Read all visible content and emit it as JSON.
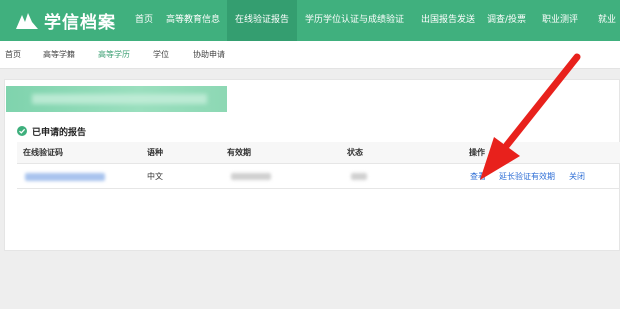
{
  "brand": {
    "name": "学信档案",
    "accent": "#40b07e"
  },
  "topnav": {
    "items": [
      {
        "label": "首页"
      },
      {
        "label": "高等教育信息"
      },
      {
        "label": "在线验证报告"
      },
      {
        "label": "学历学位认证与成绩验证"
      },
      {
        "label": "出国报告发送"
      },
      {
        "label": "调查/投票"
      },
      {
        "label": "职业测评"
      },
      {
        "label": "就业"
      }
    ],
    "active_index": 2
  },
  "subnav": {
    "items": [
      {
        "label": "首页"
      },
      {
        "label": "高等学籍"
      },
      {
        "label": "高等学历"
      },
      {
        "label": "学位"
      },
      {
        "label": "协助申请"
      }
    ],
    "active_index": 2
  },
  "section": {
    "title": "已申请的报告",
    "icon": "check-circle-icon"
  },
  "table": {
    "headers": [
      "在线验证码",
      "语种",
      "有效期",
      "状态",
      "操作"
    ],
    "row": {
      "language": "中文",
      "actions": [
        "查看",
        "延长验证有效期",
        "关闭"
      ]
    }
  },
  "colors": {
    "link": "#2f6fd6",
    "arrow": "#e8211c"
  }
}
